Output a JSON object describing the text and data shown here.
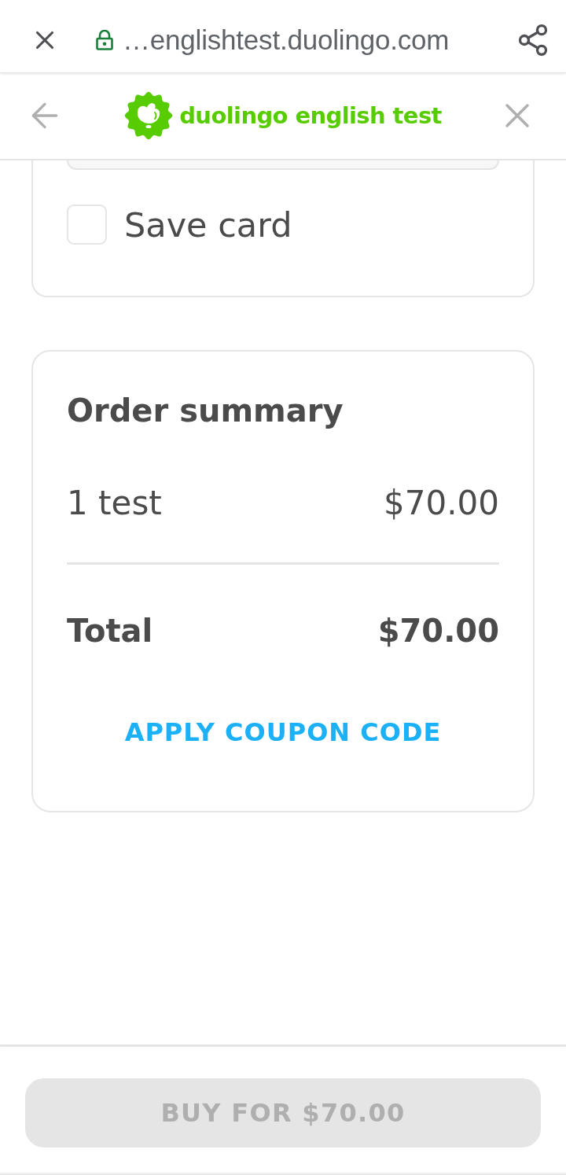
{
  "browser": {
    "url": "…englishtest.duolingo.com"
  },
  "header": {
    "logo_text": "duolingo english test"
  },
  "payment_card": {
    "save_card": {
      "label": "Save card",
      "checked": false
    }
  },
  "order_summary": {
    "title": "Order summary",
    "items": [
      {
        "label": "1 test",
        "price": "$70.00"
      }
    ],
    "total": {
      "label": "Total",
      "amount": "$70.00"
    },
    "coupon_link": "APPLY COUPON CODE"
  },
  "buy_button": {
    "label": "BUY FOR $70.00",
    "disabled": true
  }
}
